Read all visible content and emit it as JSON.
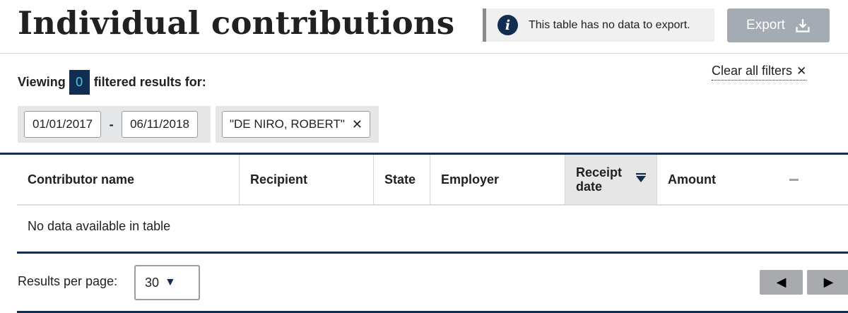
{
  "page": {
    "title": "Individual contributions"
  },
  "export_notice": {
    "icon": "info-icon",
    "text": "This table has no data to export."
  },
  "export_button": {
    "label": "Export",
    "icon": "download-icon",
    "enabled": false
  },
  "filters": {
    "viewing_prefix": "Viewing",
    "result_count": "0",
    "viewing_suffix": "filtered results for:",
    "clear_all_label": "Clear all filters",
    "date_range": {
      "start": "01/01/2017",
      "separator": "-",
      "end": "06/11/2018"
    },
    "contributor_name": "\"DE NIRO, ROBERT\""
  },
  "table": {
    "columns": [
      {
        "label": "Contributor name"
      },
      {
        "label": "Recipient"
      },
      {
        "label": "State"
      },
      {
        "label": "Employer"
      },
      {
        "label_line1": "Receipt",
        "label_line2": "date",
        "sorted": "descending"
      },
      {
        "label": "Amount"
      }
    ],
    "empty_message": "No data available in table"
  },
  "pagination": {
    "per_page_label": "Results per page:",
    "per_page_value": "30",
    "prev_icon": "triangle-left-icon",
    "next_icon": "triangle-right-icon"
  },
  "colors": {
    "navy": "#112e51",
    "badge_text": "#3fd1e6",
    "disabled_button": "#a4abb3",
    "filter_tag_bg": "#e4e6e8"
  }
}
